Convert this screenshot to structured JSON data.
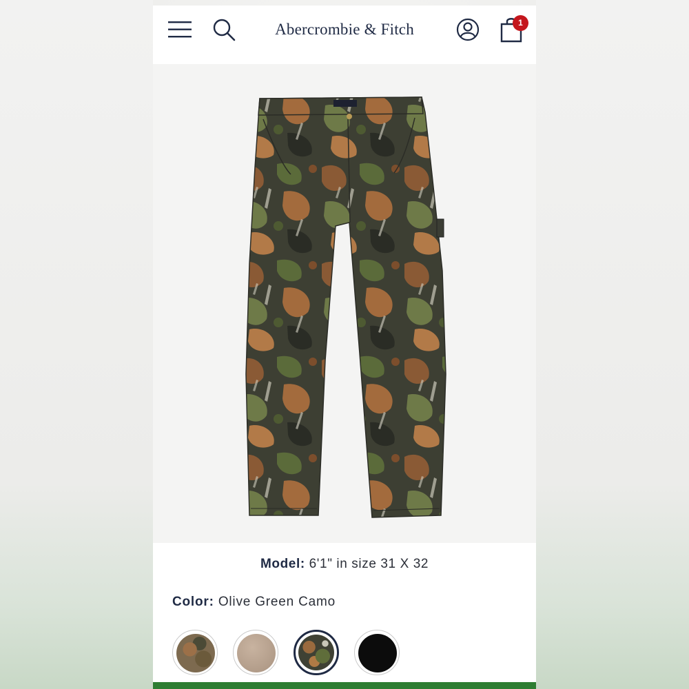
{
  "header": {
    "brand": "Abercrombie & Fitch",
    "cart_count": "1"
  },
  "product": {
    "model_label": "Model:",
    "model_value": "6'1\" in size 31 X 32",
    "color_label": "Color:",
    "color_value": "Olive Green Camo",
    "swatches": [
      {
        "name": "Brown Camo",
        "selected": false
      },
      {
        "name": "Khaki",
        "selected": false
      },
      {
        "name": "Olive Green Camo",
        "selected": true
      },
      {
        "name": "Black",
        "selected": false
      }
    ]
  },
  "icons": {
    "menu": "hamburger-menu-icon",
    "search": "search-icon",
    "account": "account-icon",
    "bag": "shopping-bag-icon"
  },
  "colors": {
    "brand_navy": "#1f2a44",
    "badge_red": "#c4161c",
    "footer_green": "#2e7d32"
  }
}
